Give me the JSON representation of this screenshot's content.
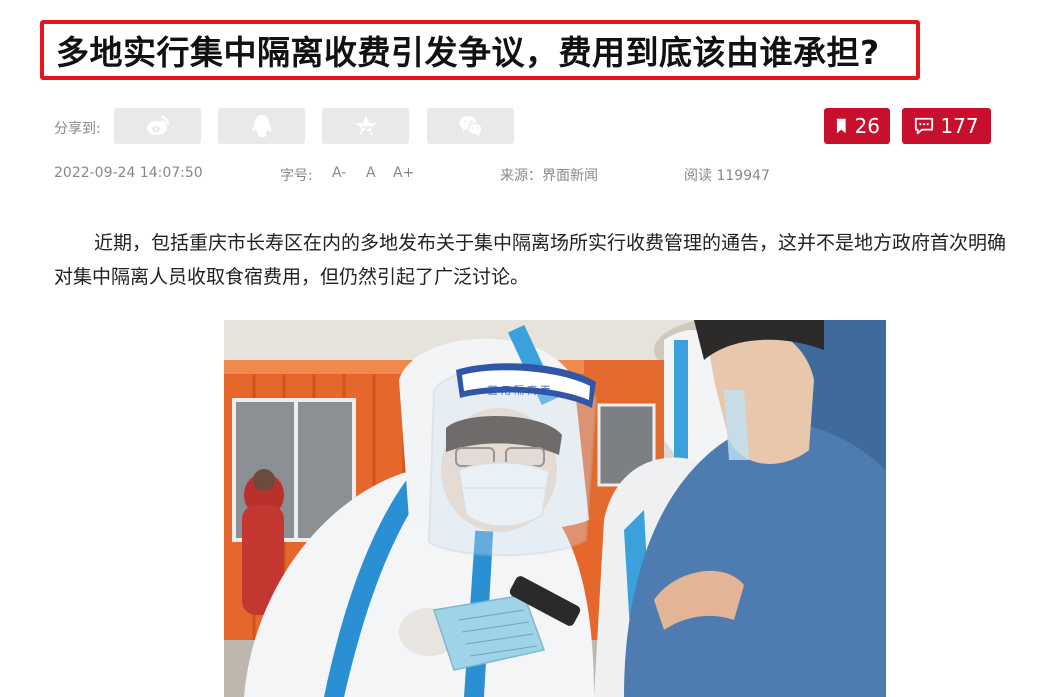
{
  "article": {
    "title": "多地实行集中隔离收费引发争议，费用到底该由谁承担?",
    "share": {
      "label": "分享到:",
      "buttons": [
        {
          "icon": "weibo-icon"
        },
        {
          "icon": "qq-icon"
        },
        {
          "icon": "qzone-star-icon"
        },
        {
          "icon": "wechat-icon"
        }
      ]
    },
    "bookmark_count": "26",
    "comment_count": "177",
    "meta": {
      "datetime": "2022-09-24 14:07:50",
      "font_size_label": "字号:",
      "font_small": "A-",
      "font_normal": "A",
      "font_large": "A+",
      "source": "来源：界面新闻",
      "reads": "阅读 119947"
    },
    "body": "近期，包括重庆市长寿区在内的多地发布关于集中隔离场所实行收费管理的通告，这并不是地方政府首次明确对集中隔离人员收取食宿费用，但仍然引起了广泛讨论。",
    "photo": {
      "headband_text": "医 用 隔 离 面"
    }
  },
  "colors": {
    "title_border": "#e8141c",
    "badge_bg": "#c8102e",
    "share_btn_bg": "#e9e9e9",
    "meta_text": "#888888"
  }
}
